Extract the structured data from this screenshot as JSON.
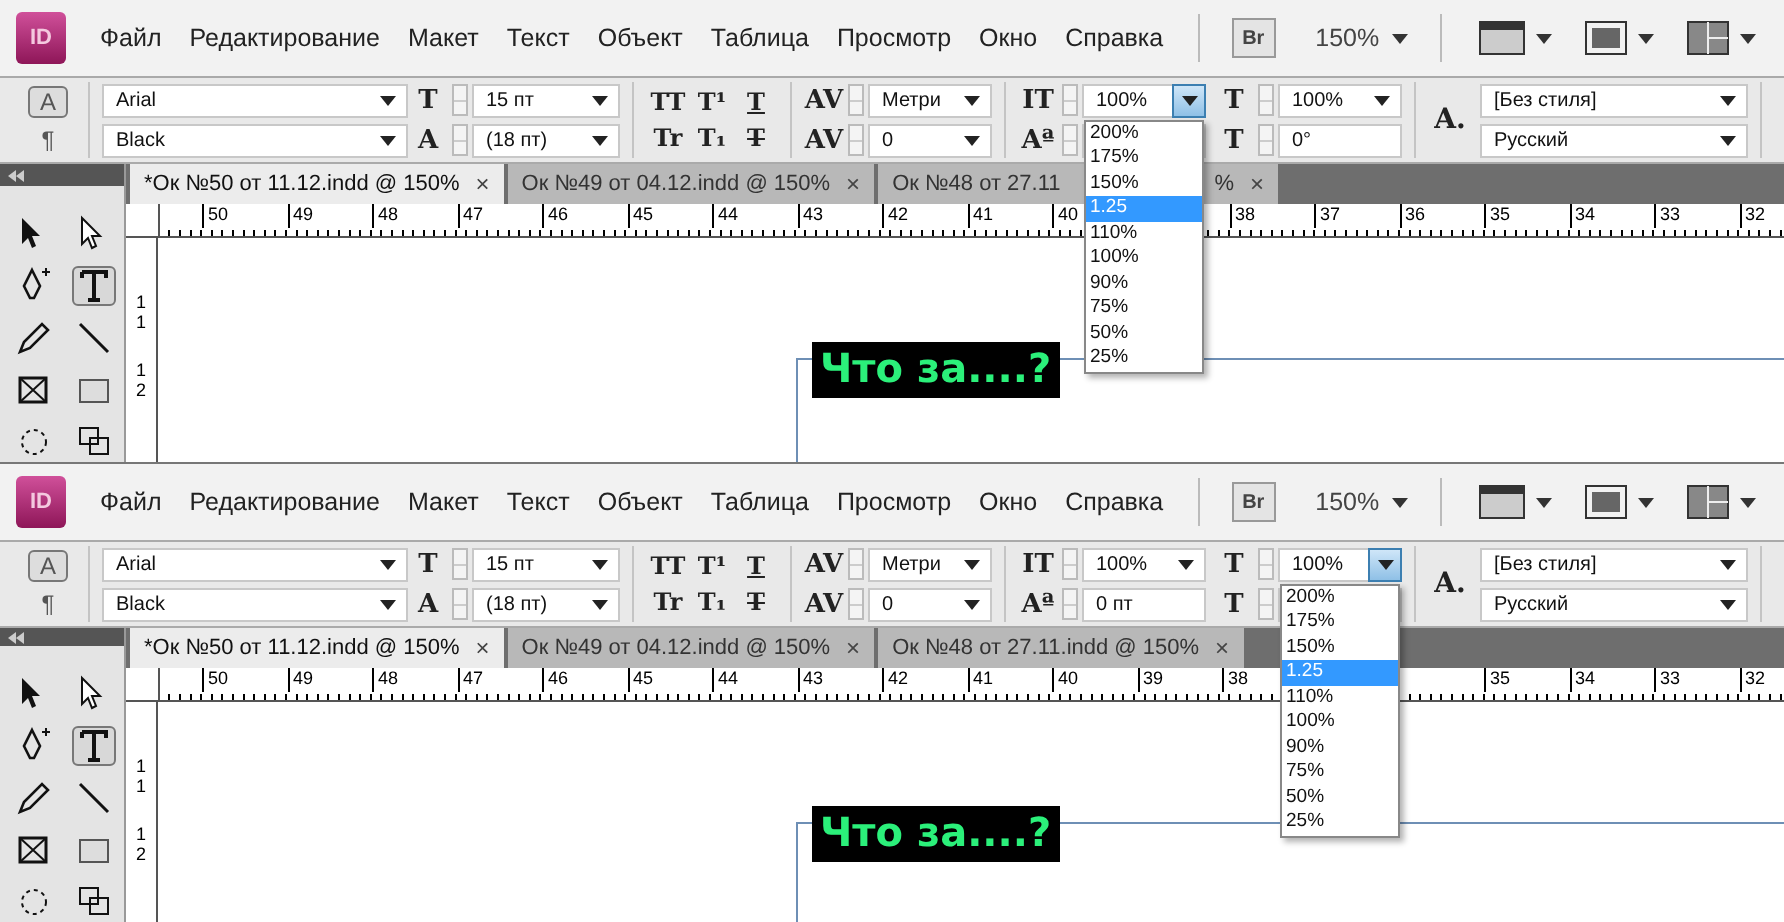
{
  "screens": [
    {
      "menu": {
        "logo": "ID",
        "items": [
          "Файл",
          "Редактирование",
          "Макет",
          "Текст",
          "Объект",
          "Таблица",
          "Просмотр",
          "Окно",
          "Справка"
        ],
        "bridge": "Br",
        "zoom": "150%"
      },
      "panel": {
        "modes": [
          {
            "label": "A",
            "selected": true
          },
          {
            "label": "¶",
            "selected": false
          }
        ],
        "font": {
          "family": "Arial",
          "style": "Black"
        },
        "size": [
          {
            "glyph": "T",
            "value": "15 пт"
          },
          {
            "glyph": "A",
            "value": "(18 пт)"
          }
        ],
        "styles": [
          {
            "label": "TT",
            "kind": "plain"
          },
          {
            "label": "T¹",
            "kind": "plain"
          },
          {
            "label": "T",
            "kind": "underline"
          },
          {
            "label": "Tr",
            "kind": "plain"
          },
          {
            "label": "T₁",
            "kind": "plain"
          },
          {
            "label": "T",
            "kind": "strike"
          }
        ],
        "spacing": [
          {
            "glyph": "AV",
            "value": "Метри"
          },
          {
            "glyph": "AV",
            "value": "0"
          }
        ],
        "scale": [
          {
            "glyph": "IT",
            "value": "100%",
            "kind": "combo",
            "open": true
          },
          {
            "glyph": "Aª",
            "kind": "text",
            "open": false
          }
        ],
        "scale2": [
          {
            "glyph": "T",
            "value": "100%",
            "kind": "combo",
            "open": false
          },
          {
            "glyph": "T",
            "value": "0°",
            "kind": "text",
            "open": false
          }
        ],
        "char_style": {
          "glyph": "A.",
          "style": "[Без стиля]",
          "language": "Русский"
        }
      },
      "dropdown": [
        {
          "label": "200%",
          "selected": false
        },
        {
          "label": "175%",
          "selected": false
        },
        {
          "label": "150%",
          "selected": false
        },
        {
          "label": "1.25",
          "selected": true
        },
        {
          "label": "110%",
          "selected": false
        },
        {
          "label": "100%",
          "selected": false
        },
        {
          "label": "90%",
          "selected": false
        },
        {
          "label": "75%",
          "selected": false
        },
        {
          "label": "50%",
          "selected": false
        },
        {
          "label": "25%",
          "selected": false
        }
      ],
      "tabs": [
        {
          "label": "*Ок №50 от 11.12.indd @ 150%",
          "selected": true,
          "close": "×"
        },
        {
          "label": "Ок №49 от 04.12.indd @ 150%",
          "selected": false,
          "close": "×"
        },
        {
          "label": "Ок №48 от 27.11",
          "label_tail": "%",
          "selected": false,
          "close": "×"
        }
      ],
      "ruler": [
        [
          "50",
          "49",
          "48",
          "47",
          "46",
          "45",
          "44",
          "43",
          "42",
          "41",
          "40"
        ],
        [
          "38",
          "37",
          "36",
          "35",
          "34",
          "33",
          "32"
        ]
      ],
      "vruler": [
        "11",
        "12"
      ],
      "text_frame": "Что за....?"
    },
    {
      "menu": {
        "logo": "ID",
        "items": [
          "Файл",
          "Редактирование",
          "Макет",
          "Текст",
          "Объект",
          "Таблица",
          "Просмотр",
          "Окно",
          "Справка"
        ],
        "bridge": "Br",
        "zoom": "150%"
      },
      "panel": {
        "modes": [
          {
            "label": "A",
            "selected": true
          },
          {
            "label": "¶",
            "selected": false
          }
        ],
        "font": {
          "family": "Arial",
          "style": "Black"
        },
        "size": [
          {
            "glyph": "T",
            "value": "15 пт"
          },
          {
            "glyph": "A",
            "value": "(18 пт)"
          }
        ],
        "styles": [
          {
            "label": "TT",
            "kind": "plain"
          },
          {
            "label": "T¹",
            "kind": "plain"
          },
          {
            "label": "T",
            "kind": "underline"
          },
          {
            "label": "Tr",
            "kind": "plain"
          },
          {
            "label": "T₁",
            "kind": "plain"
          },
          {
            "label": "T",
            "kind": "strike"
          }
        ],
        "spacing": [
          {
            "glyph": "AV",
            "value": "Метри"
          },
          {
            "glyph": "AV",
            "value": "0"
          }
        ],
        "scale": [
          {
            "glyph": "IT",
            "value": "100%",
            "kind": "combo",
            "open": false
          },
          {
            "glyph": "Aª",
            "value": "0 пт",
            "kind": "text",
            "open": false
          }
        ],
        "scale2": [
          {
            "glyph": "T",
            "value": "100%",
            "kind": "combo",
            "open": true
          },
          {
            "glyph": "T",
            "kind": "text",
            "open": false
          }
        ],
        "char_style": {
          "glyph": "A.",
          "style": "[Без стиля]",
          "language": "Русский"
        }
      },
      "dropdown": [
        {
          "label": "200%",
          "selected": false
        },
        {
          "label": "175%",
          "selected": false
        },
        {
          "label": "150%",
          "selected": false
        },
        {
          "label": "1.25",
          "selected": true
        },
        {
          "label": "110%",
          "selected": false
        },
        {
          "label": "100%",
          "selected": false
        },
        {
          "label": "90%",
          "selected": false
        },
        {
          "label": "75%",
          "selected": false
        },
        {
          "label": "50%",
          "selected": false
        },
        {
          "label": "25%",
          "selected": false
        }
      ],
      "tabs": [
        {
          "label": "*Ок №50 от 11.12.indd @ 150%",
          "selected": true,
          "close": "×"
        },
        {
          "label": "Ок №49 от 04.12.indd @ 150%",
          "selected": false,
          "close": "×"
        },
        {
          "label": "Ок №48 от 27.11.indd @ 150%",
          "selected": false,
          "close": "×"
        }
      ],
      "ruler": [
        [
          "50",
          "49",
          "48",
          "47",
          "46",
          "45",
          "44",
          "43",
          "42",
          "41",
          "40",
          "39",
          "38"
        ],
        [
          "35",
          "34",
          "33",
          "32"
        ]
      ],
      "vruler": [
        "11",
        "12"
      ],
      "text_frame": "Что за....?"
    }
  ]
}
